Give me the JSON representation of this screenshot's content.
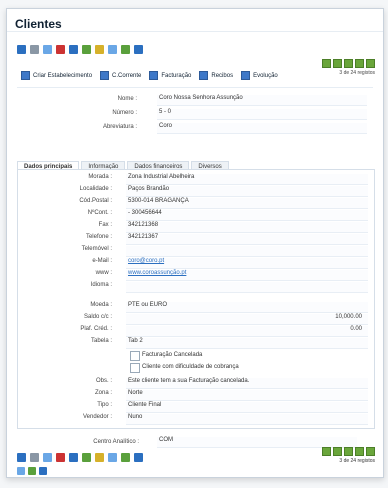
{
  "window": {
    "title": "Clientes"
  },
  "toolbar": {
    "icons": [
      "new-icon",
      "search-icon",
      "copy-icon",
      "delete-icon",
      "close-icon",
      "refresh-icon",
      "star-icon",
      "filter-icon",
      "arrow-icon",
      "print-icon"
    ]
  },
  "pager": {
    "count_text": "3 de 24 registos"
  },
  "links": [
    {
      "label": "Criar Estabelecimento"
    },
    {
      "label": "C.Corrente"
    },
    {
      "label": "Facturação"
    },
    {
      "label": "Recibos"
    },
    {
      "label": "Evolução"
    }
  ],
  "header_fields": {
    "nome": {
      "label": "Nome :",
      "value": "Coro Nossa Senhora Assunção"
    },
    "numero": {
      "label": "Número :",
      "value": "5 - 0"
    },
    "abreviatura": {
      "label": "Abreviatura :",
      "value": "Coro"
    }
  },
  "tabs": [
    {
      "label": "Dados principais",
      "active": true
    },
    {
      "label": "Informação",
      "active": false
    },
    {
      "label": "Dados financeiros",
      "active": false
    },
    {
      "label": "Diversos",
      "active": false
    }
  ],
  "main": {
    "morada": {
      "label": "Morada :",
      "value": "Zona Industrial Abelheira"
    },
    "localidade": {
      "label": "Localidade :",
      "value": "Paços Brandão"
    },
    "codpostal": {
      "label": "Cód.Postal :",
      "value": "5300-014 BRAGANÇA"
    },
    "ncont": {
      "label": "NºCont. :",
      "value": "- 300456644"
    },
    "fax": {
      "label": "Fax :",
      "value": "342121368"
    },
    "telefone": {
      "label": "Telefone :",
      "value": "342121367"
    },
    "telemovel": {
      "label": "Telemóvel :",
      "value": ""
    },
    "email": {
      "label": "e-Mail :",
      "value": "coro@coro.pt"
    },
    "www": {
      "label": "www :",
      "value": "www.coroassunção.pt"
    },
    "idioma": {
      "label": "Idioma :",
      "value": ""
    },
    "moeda": {
      "label": "Moeda :",
      "value": "PTE ou EURO"
    },
    "saldo": {
      "label": "Saldo c/c :",
      "value": "10,000.00"
    },
    "plafcred": {
      "label": "Plaf. Créd. :",
      "value": "0.00"
    },
    "tabela": {
      "label": "Tabela :",
      "value": "Tab 2"
    },
    "check1": {
      "label": "Facturação Cancelada"
    },
    "check2": {
      "label": "Cliente com dificuldade de cobrança"
    },
    "obs": {
      "label": "Obs. :",
      "value": "Este cliente tem a sua Facturação cancelada."
    },
    "zona": {
      "label": "Zona :",
      "value": "Norte"
    },
    "tipo": {
      "label": "Tipo :",
      "value": "Cliente Final"
    },
    "vendedor": {
      "label": "Vendedor :",
      "value": "Nuno"
    },
    "centro": {
      "label": "Centro Analítico :",
      "value": "COM"
    }
  },
  "bottom_pager": {
    "count_text": "3 de 24 registos"
  }
}
